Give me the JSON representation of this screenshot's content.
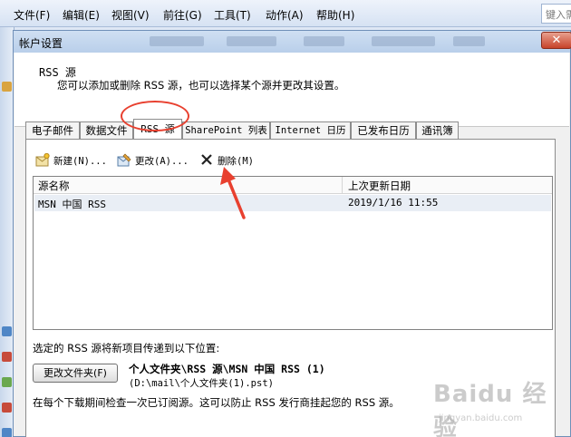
{
  "menubar": {
    "items": [
      "文件(F)",
      "编辑(E)",
      "视图(V)",
      "前往(G)",
      "工具(T)",
      "动作(A)",
      "帮助(H)"
    ],
    "search_placeholder": "键入需"
  },
  "dialog": {
    "title": "帐户设置",
    "close_glyph": "✕",
    "header": {
      "title": "RSS 源",
      "description": "您可以添加或删除 RSS 源，也可以选择某个源并更改其设置。"
    },
    "tabs": [
      {
        "label": "电子邮件",
        "active": false
      },
      {
        "label": "数据文件",
        "active": false
      },
      {
        "label": "RSS 源",
        "active": true
      },
      {
        "label": "SharePoint 列表",
        "active": false
      },
      {
        "label": "Internet 日历",
        "active": false
      },
      {
        "label": "已发布日历",
        "active": false
      },
      {
        "label": "通讯簿",
        "active": false
      }
    ],
    "toolbar": {
      "new_label": "新建(N)...",
      "change_label": "更改(A)...",
      "delete_label": "删除(M)"
    },
    "list": {
      "columns": [
        "源名称",
        "上次更新日期"
      ],
      "rows": [
        {
          "name": "MSN 中国 RSS",
          "date": "2019/1/16 11:55"
        }
      ]
    },
    "deliver_label": "选定的 RSS 源将新项目传递到以下位置:",
    "change_folder_label": "更改文件夹(F)",
    "folder_name": "个人文件夹\\RSS 源\\MSN 中国 RSS (1)",
    "folder_path": "(D:\\mail\\个人文件夹(1).pst)",
    "footer_note": "在每个下载期间检查一次已订阅源。这可以防止 RSS 发行商挂起您的 RSS 源。"
  },
  "colors": {
    "annotation": "#e8402f",
    "selection_row": "#e9eef5",
    "title_gradient_top": "#cfdff2"
  },
  "watermark": {
    "text": "Baidu 经验",
    "sub": "jingyan.baidu.com"
  }
}
